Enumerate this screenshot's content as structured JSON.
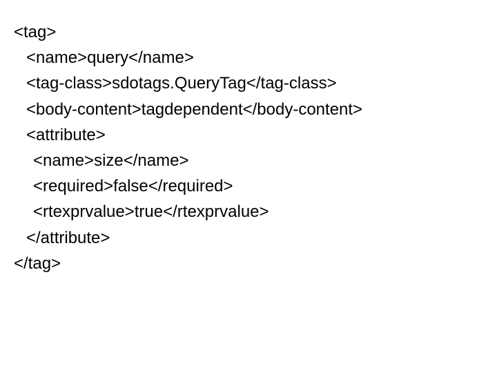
{
  "lines": {
    "l0": "<tag>",
    "l1": "<name>query</name>",
    "l2": "<tag-class>sdotags.QueryTag</tag-class>",
    "l3": "<body-content>tagdependent</body-content>",
    "l4": "<attribute>",
    "l5": "<name>size</name>",
    "l6": "<required>false</required>",
    "l7": "<rtexprvalue>true</rtexprvalue>",
    "l8": "</attribute>",
    "l9": "</tag>"
  },
  "xml_data": {
    "tag": {
      "name": "query",
      "tag_class": "sdotags.QueryTag",
      "body_content": "tagdependent",
      "attribute": {
        "name": "size",
        "required": "false",
        "rtexprvalue": "true"
      }
    }
  }
}
